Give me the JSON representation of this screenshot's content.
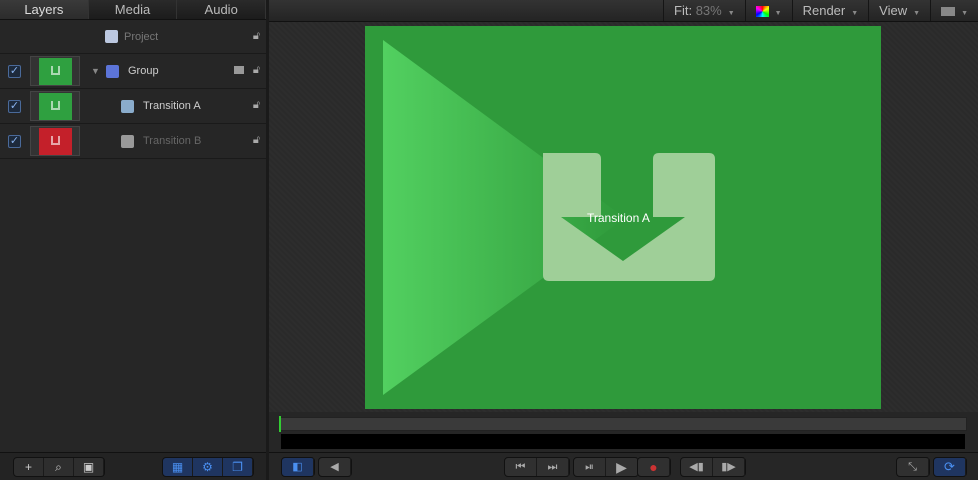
{
  "left_panel": {
    "tabs": [
      "Layers",
      "Media",
      "Audio"
    ],
    "project": {
      "label": "Project"
    },
    "layers": [
      {
        "label": "Group",
        "checked": true,
        "thumb_color": "#2fa040"
      },
      {
        "label": "Transition A",
        "checked": true,
        "thumb_color": "#2fa040"
      },
      {
        "label": "Transition B",
        "checked": true,
        "thumb_color": "#c4202a"
      }
    ],
    "bottom_buttons": [
      "add-icon",
      "search-icon",
      "layout-icon"
    ],
    "bottom_toggles": [
      "grid-icon",
      "gear-icon",
      "layers-icon"
    ]
  },
  "viewer": {
    "fit_label": "Fit:",
    "fit_value": "83%",
    "render_label": "Render",
    "view_label": "View",
    "canvas_text": "Transition A",
    "canvas_color": "#2f9a3b"
  }
}
